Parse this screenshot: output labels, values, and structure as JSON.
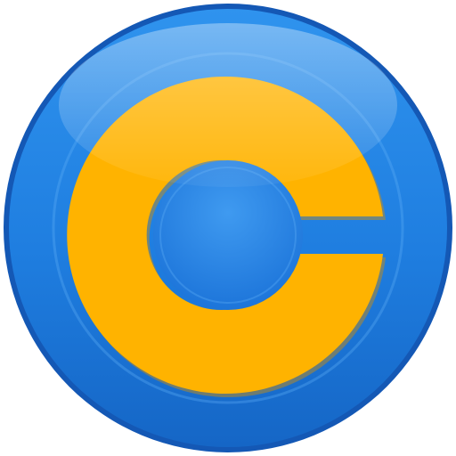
{
  "logo": {
    "icon": "c-letter-logo-icon",
    "colors": {
      "disc_top": "#2f93ee",
      "disc_mid": "#1f7ee0",
      "disc_bottom": "#1566c6",
      "rim_dark": "#1458b5",
      "ring_light": "#5fb0f5",
      "letter": "#ffb300",
      "letter_shadow": "#d88d00",
      "inner_disc": "#1c7ae0",
      "gloss": "#ffffff"
    }
  }
}
